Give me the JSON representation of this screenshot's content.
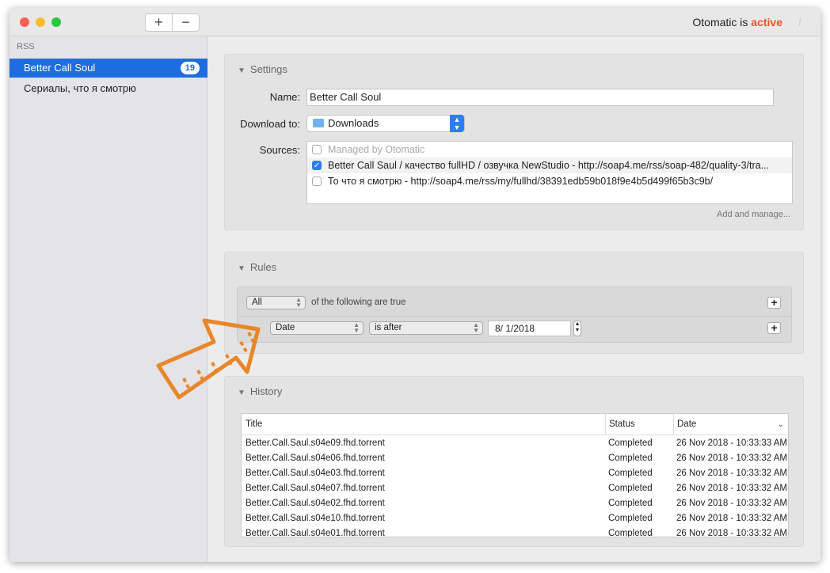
{
  "titlebar": {
    "add": "+",
    "remove": "−",
    "status_prefix": "Otomatic is",
    "status_value": "active",
    "info": "i",
    "accent": "#f0532b"
  },
  "sidebar": {
    "header": "RSS",
    "items": [
      {
        "label": "Better Call Soul",
        "count": "19",
        "selected": true
      },
      {
        "label": "Сериалы, что я смотрю"
      }
    ]
  },
  "settings": {
    "title": "Settings",
    "name_label": "Name:",
    "name_value": "Better Call Soul",
    "download_label": "Download to:",
    "download_value": "Downloads",
    "sources_label": "Sources:",
    "sources": [
      {
        "label": "Managed by Otomatic",
        "checked": false,
        "disabled": true
      },
      {
        "label": "Better Call Saul / качество fullHD / озвучка NewStudio - http://soap4.me/rss/soap-482/quality-3/tra...",
        "checked": true
      },
      {
        "label": "То что я смотрю - http://soap4.me/rss/my/fullhd/38391edb59b018f9e4b5d499f65b3c9b/",
        "checked": false
      }
    ],
    "add_manage": "Add and manage..."
  },
  "rules": {
    "title": "Rules",
    "match": "All",
    "match_text": "of the following are true",
    "field": "Date",
    "operator": "is after",
    "value": "8/  1/2018",
    "add": "+"
  },
  "history": {
    "title": "History",
    "columns": [
      "Title",
      "Status",
      "Date"
    ],
    "rows": [
      [
        "Better.Call.Saul.s04e09.fhd.torrent",
        "Completed",
        "26 Nov 2018 - 10:33:33 AM"
      ],
      [
        "Better.Call.Saul.s04e06.fhd.torrent",
        "Completed",
        "26 Nov 2018 - 10:33:32 AM"
      ],
      [
        "Better.Call.Saul.s04e03.fhd.torrent",
        "Completed",
        "26 Nov 2018 - 10:33:32 AM"
      ],
      [
        "Better.Call.Saul.s04e07.fhd.torrent",
        "Completed",
        "26 Nov 2018 - 10:33:32 AM"
      ],
      [
        "Better.Call.Saul.s04e02.fhd.torrent",
        "Completed",
        "26 Nov 2018 - 10:33:32 AM"
      ],
      [
        "Better.Call.Saul.s04e10.fhd.torrent",
        "Completed",
        "26 Nov 2018 - 10:33:32 AM"
      ],
      [
        "Better.Call.Saul.s04e01.fhd.torrent",
        "Completed",
        "26 Nov 2018 - 10:33:32 AM"
      ]
    ]
  },
  "annotation": {
    "arrow_color": "#e8862a"
  }
}
